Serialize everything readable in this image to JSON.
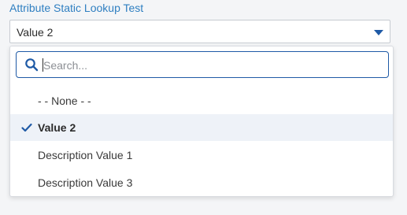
{
  "field": {
    "label": "Attribute Static Lookup Test",
    "selected_value": "Value 2"
  },
  "search": {
    "placeholder": "Search...",
    "value": ""
  },
  "options": [
    {
      "label": "- - None - -",
      "selected": false
    },
    {
      "label": "Value 2",
      "selected": true
    },
    {
      "label": "Description Value 1",
      "selected": false
    },
    {
      "label": "Description Value 3",
      "selected": false
    }
  ],
  "colors": {
    "accent": "#1f5aa6",
    "label": "#2f7fc1",
    "selected_row_bg": "#eef2f8"
  },
  "icons": {
    "dropdown": "caret-down-icon",
    "search": "search-icon",
    "selected": "checkmark-icon"
  }
}
